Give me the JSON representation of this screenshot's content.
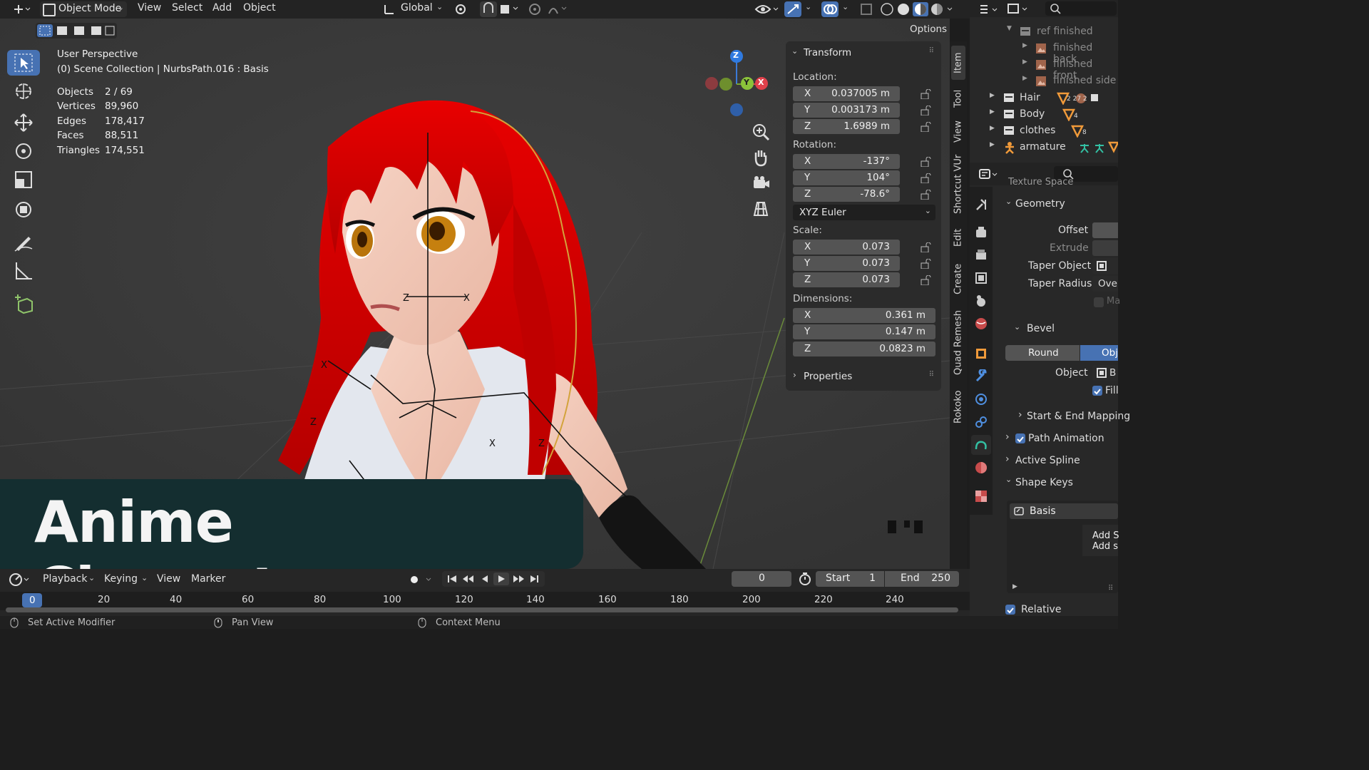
{
  "topbar": {
    "mode": "Object Mode",
    "menus": [
      "View",
      "Select",
      "Add",
      "Object"
    ],
    "orientation": "Global",
    "options_label": "Options"
  },
  "viewport": {
    "perspective": "User Perspective",
    "collection": "(0) Scene Collection | NurbsPath.016 : Basis",
    "stats": [
      {
        "label": "Objects",
        "value": "2 / 69"
      },
      {
        "label": "Vertices",
        "value": "89,960"
      },
      {
        "label": "Edges",
        "value": "178,417"
      },
      {
        "label": "Faces",
        "value": "88,511"
      },
      {
        "label": "Triangles",
        "value": "174,551"
      }
    ],
    "gizmo": {
      "z": "Z",
      "y": "Y",
      "x": "X"
    }
  },
  "npanel": {
    "transform_title": "Transform",
    "location_label": "Location:",
    "location": [
      {
        "axis": "X",
        "value": "0.037005 m"
      },
      {
        "axis": "Y",
        "value": "0.003173 m"
      },
      {
        "axis": "Z",
        "value": "1.6989 m"
      }
    ],
    "rotation_label": "Rotation:",
    "rotation": [
      {
        "axis": "X",
        "value": "-137°"
      },
      {
        "axis": "Y",
        "value": "104°"
      },
      {
        "axis": "Z",
        "value": "-78.6°"
      }
    ],
    "rotation_mode": "XYZ Euler",
    "scale_label": "Scale:",
    "scale": [
      {
        "axis": "X",
        "value": "0.073"
      },
      {
        "axis": "Y",
        "value": "0.073"
      },
      {
        "axis": "Z",
        "value": "0.073"
      }
    ],
    "dimensions_label": "Dimensions:",
    "dimensions": [
      {
        "axis": "X",
        "value": "0.361 m"
      },
      {
        "axis": "Y",
        "value": "0.147 m"
      },
      {
        "axis": "Z",
        "value": "0.0823 m"
      }
    ],
    "properties_title": "Properties"
  },
  "side_tabs": [
    "Item",
    "Tool",
    "View",
    "Shortcut VUr",
    "Edit",
    "Create",
    "Quad Remesh",
    "Rokoko"
  ],
  "outliner": {
    "rows": [
      {
        "label": "ref finished",
        "dim": true
      },
      {
        "label": "finished back",
        "dim": true
      },
      {
        "label": "finished front",
        "dim": true
      },
      {
        "label": "finished side",
        "dim": true
      },
      {
        "label": "Hair",
        "dim": false,
        "badge": "2 27 2"
      },
      {
        "label": "Body",
        "dim": false,
        "badge": "4"
      },
      {
        "label": "clothes",
        "dim": false,
        "badge": "8"
      },
      {
        "label": "armature",
        "dim": false,
        "badge": ""
      }
    ]
  },
  "properties": {
    "texture_space": "Texture Space",
    "geometry": "Geometry",
    "offset": "Offset",
    "extrude": "Extrude",
    "taper_object": "Taper Object",
    "taper_radius": "Taper Radius",
    "taper_radius_value": "Over",
    "bevel": "Bevel",
    "round": "Round",
    "obj": "Obj",
    "object": "Object",
    "object_value": "B",
    "fill": "Fill",
    "start_end_mapping": "Start & End Mapping",
    "path_animation": "Path Animation",
    "active_spline": "Active Spline",
    "shape_keys": "Shape Keys",
    "basis": "Basis",
    "add_s1": "Add S",
    "add_s2": "Add s",
    "relative": "Relative"
  },
  "timeline": {
    "menus": [
      "Playback",
      "Keying",
      "View",
      "Marker"
    ],
    "current_frame": "0",
    "start_label": "Start",
    "start_value": "1",
    "end_label": "End",
    "end_value": "250",
    "ruler": [
      "20",
      "40",
      "60",
      "80",
      "100",
      "120",
      "140",
      "160",
      "180",
      "200",
      "220",
      "240"
    ],
    "playhead": "0"
  },
  "statusbar": {
    "items": [
      "Set Active Modifier",
      "Pan View",
      "Context Menu"
    ]
  },
  "banner": {
    "title": "Anime Characters"
  },
  "colors": {
    "accent": "#4772b3",
    "hair": "#d40000",
    "banner_bg": "#142e30"
  }
}
